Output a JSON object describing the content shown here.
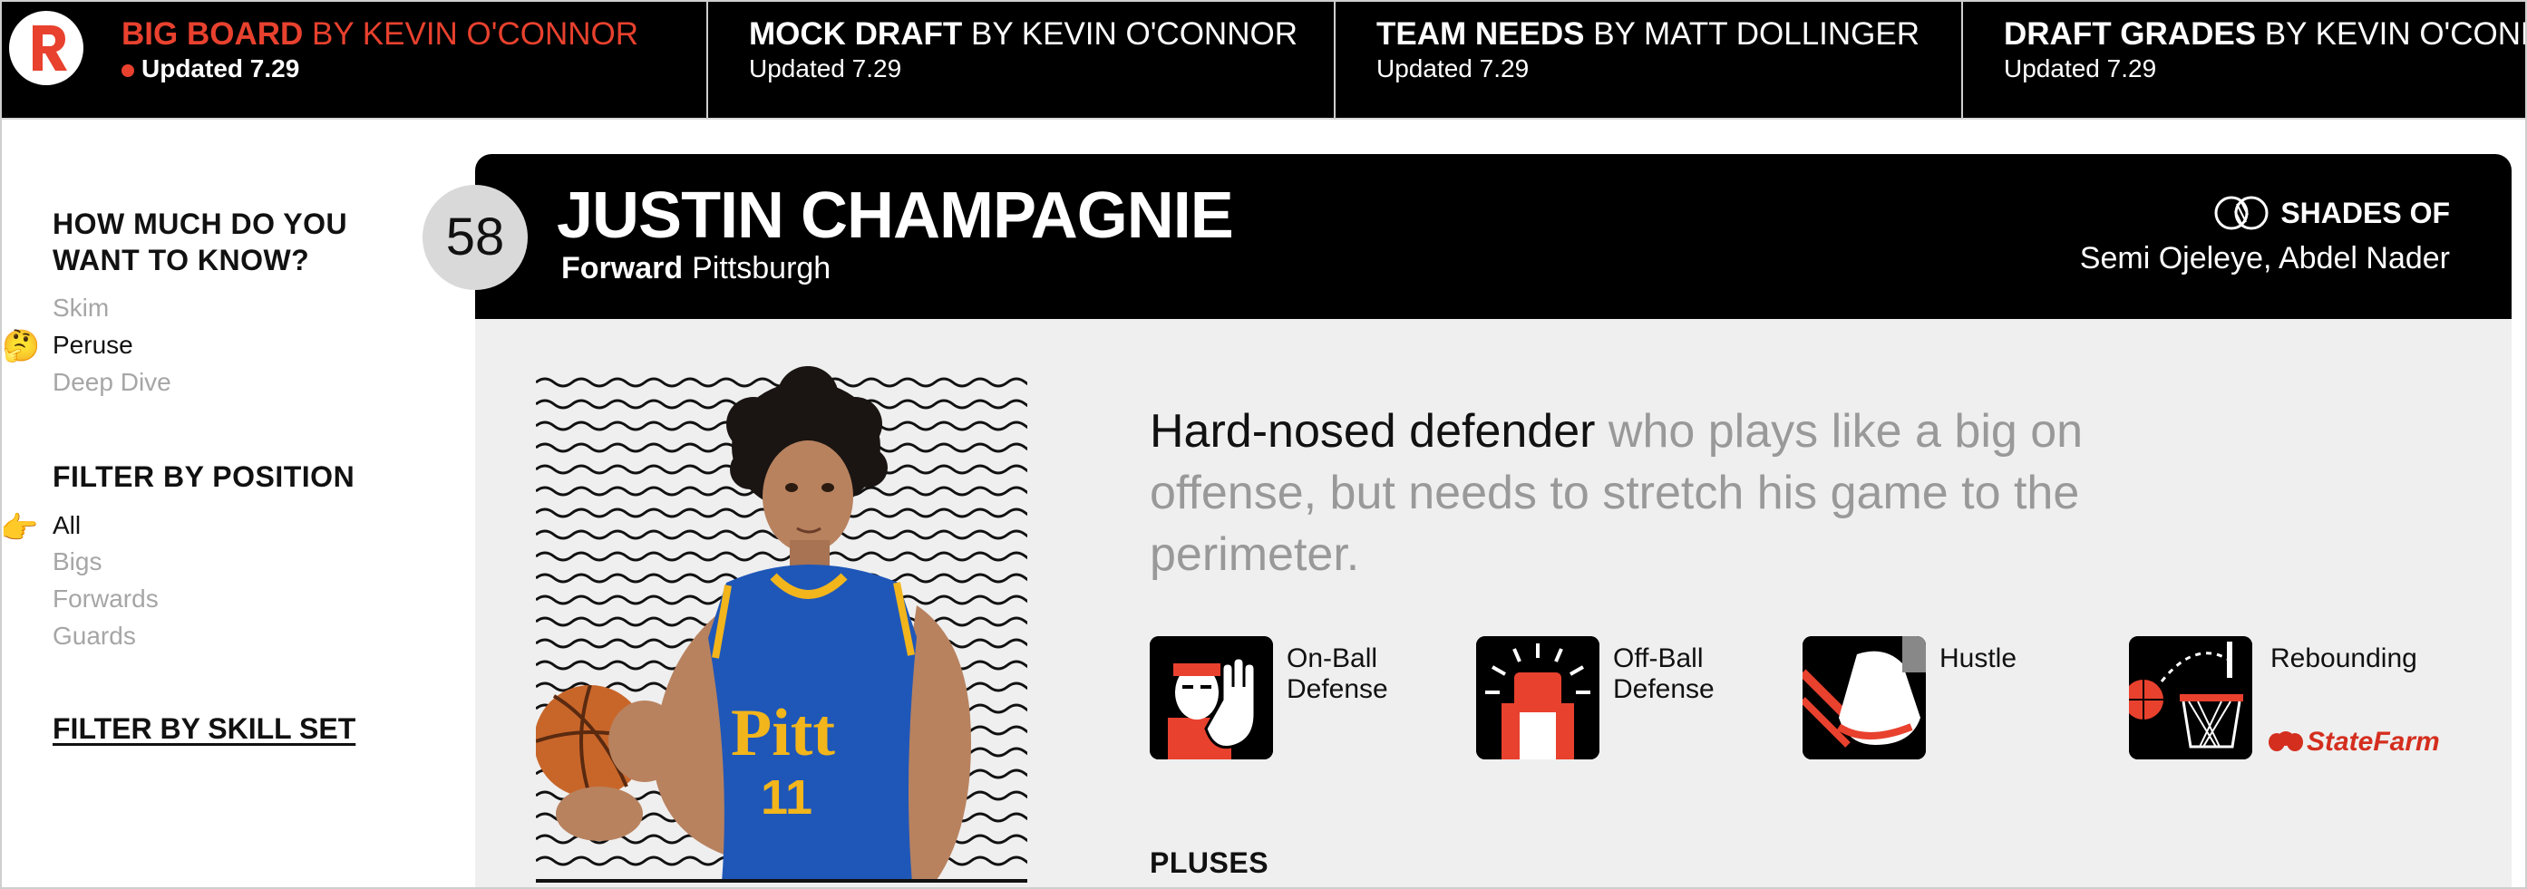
{
  "nav": {
    "tabs": [
      {
        "title": "BIG BOARD",
        "by": "BY KEVIN O'CONNOR",
        "updated": "Updated 7.29"
      },
      {
        "title": "MOCK DRAFT",
        "by": "BY KEVIN O'CONNOR",
        "updated": "Updated 7.29"
      },
      {
        "title": "TEAM NEEDS",
        "by": "BY MATT DOLLINGER",
        "updated": "Updated 7.29"
      },
      {
        "title": "DRAFT GRADES",
        "by": "BY KEVIN O'CONNOR",
        "updated": "Updated 7.29"
      }
    ],
    "logo_letter": "R",
    "colors": {
      "accent": "#e8412e",
      "bar": "#000000"
    }
  },
  "sidebar": {
    "depth_heading_line1": "HOW MUCH DO YOU",
    "depth_heading_line2": "WANT TO KNOW?",
    "depth_options": [
      "Skim",
      "Peruse",
      "Deep Dive"
    ],
    "depth_selected_emoji": "🤔",
    "position_heading": "FILTER BY POSITION",
    "position_options": [
      "All",
      "Bigs",
      "Forwards",
      "Guards"
    ],
    "position_selected_emoji": "👉",
    "skill_link": "FILTER BY SKILL SET"
  },
  "player": {
    "rank": "58",
    "name": "JUSTIN CHAMPAGNIE",
    "position": "Forward",
    "school": "Pittsburgh",
    "shades_label": "SHADES OF",
    "shades_names": "Semi Ojeleye, Abdel Nader",
    "blurb_lead": "Hard-nosed defender",
    "blurb_rest": " who plays like a big on offense, but needs to stretch his game to the perimeter.",
    "skills": [
      {
        "line1": "On-Ball",
        "line2": "Defense",
        "icon": "on-ball-defense-icon"
      },
      {
        "line1": "Off-Ball",
        "line2": "Defense",
        "icon": "off-ball-defense-icon"
      },
      {
        "line1": "Hustle",
        "line2": "",
        "icon": "hustle-icon"
      },
      {
        "line1": "Rebounding",
        "line2": "",
        "icon": "rebounding-icon"
      }
    ],
    "sponsor": "StateFarm",
    "jersey_text": "Pitt",
    "jersey_number": "11",
    "pluses_heading": "PLUSES"
  }
}
